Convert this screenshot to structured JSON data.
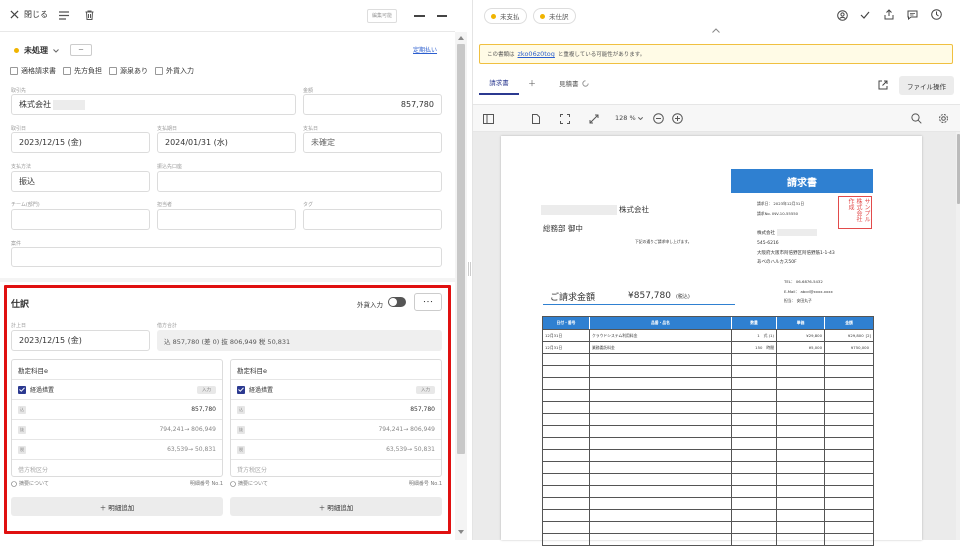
{
  "header": {
    "close_label": "閉じる",
    "draft_badge": "編集可能"
  },
  "status": {
    "label": "未処理",
    "sub_button": "－",
    "link": "定期払い"
  },
  "checkboxes": [
    "適格請求書",
    "先方負担",
    "源泉あり",
    "外貨入力"
  ],
  "form": {
    "partner_label": "取引先",
    "partner_value": "株式会社",
    "amount_label": "金額",
    "amount_value": "857,780",
    "date_label": "取引日",
    "date_value": "2023/12/15 (金)",
    "due_label": "支払期日",
    "due_value": "2024/01/31 (水)",
    "paydate_label": "支払日",
    "paydate_value": "未確定",
    "method_label": "支払方法",
    "method_value": "振込",
    "account_label": "振込先口座",
    "team_label": "チーム(部門)",
    "person_label": "担当者",
    "tag_label": "タグ",
    "subject_label": "案件"
  },
  "journal": {
    "title": "仕訳",
    "fx_label": "外貨入力",
    "more_label": "･･･",
    "date_label": "計上日",
    "date_value": "2023/12/15 (金)",
    "total_label": "借方合計",
    "total_text": "込 857,780 (差 0)  抜 806,949  税 50,831",
    "add_label": "＋ 明細追加",
    "columns": [
      {
        "account_label": "勘定科目e",
        "category": "経過措置",
        "input_badge": "入力",
        "amount": "857,780",
        "excl": "794,241→ 806,949",
        "tax": "63,539→ 50,831",
        "tax_label": "借方税区分",
        "footer_left": "摘要について",
        "footer_right": "明細番号  No.1"
      },
      {
        "account_label": "勘定科目e",
        "category": "経過措置",
        "input_badge": "入力",
        "amount": "857,780",
        "excl": "794,241→ 806,949",
        "tax": "63,539→ 50,831",
        "tax_label": "貸方税区分",
        "footer_left": "摘要について",
        "footer_right": "明細番号  No.1"
      }
    ]
  },
  "right": {
    "pill1": "未支払",
    "pill2": "未仕訳",
    "warning_text": "この書類は",
    "warning_link": "zko06z0tog",
    "warning_rest": "と重複している可能性があります。",
    "tab1": "請求書",
    "tab_plus": "＋",
    "tab2": "見積書",
    "file_ops": "ファイル操作",
    "zoom": "128 %"
  },
  "invoice": {
    "title": "請求書",
    "to_company": "株式会社",
    "to_dept": "総務部  御中",
    "greeting": "下記の通りご請求申し上げます。",
    "meta_date": "請求日：   2023年12月31日",
    "meta_no": "請求No.   INV-10-55550",
    "stamp": "サンプル株式会社作成",
    "from_company": "株式会社",
    "from_zip": "545-6216",
    "from_addr1": "大阪府大阪市阿倍野区阿倍野筋1-1-43",
    "from_addr2": "あべのハルカス50F",
    "tel": "TEL：   06-6876-5432",
    "email": "E-Mail：  abcd@xxxx.xxxx",
    "rep": "担当：  安田丸子",
    "amount_label": "ご請求金額",
    "amount_value": "¥857,780",
    "amount_tax": "(税込)",
    "table_headers": [
      "日付・番号",
      "品番・品名",
      "数量",
      "単価",
      "金額"
    ],
    "rows": [
      [
        "12月31日",
        "クラウドシステム利用料金",
        "1",
        "式 (1)",
        "¥29,800",
        "¥29,800",
        "[2]"
      ],
      [
        "12月31日",
        "業務委託料金",
        "150",
        "時間",
        "¥5,000",
        "¥750,000",
        ""
      ]
    ]
  },
  "colors": {
    "accent": "#2b3990",
    "warning_bg": "#fffbe6",
    "warning_border": "#f0c040",
    "highlight_red": "#e01010",
    "invoice_blue": "#2f80d1",
    "status_yellow": "#f0b400"
  }
}
